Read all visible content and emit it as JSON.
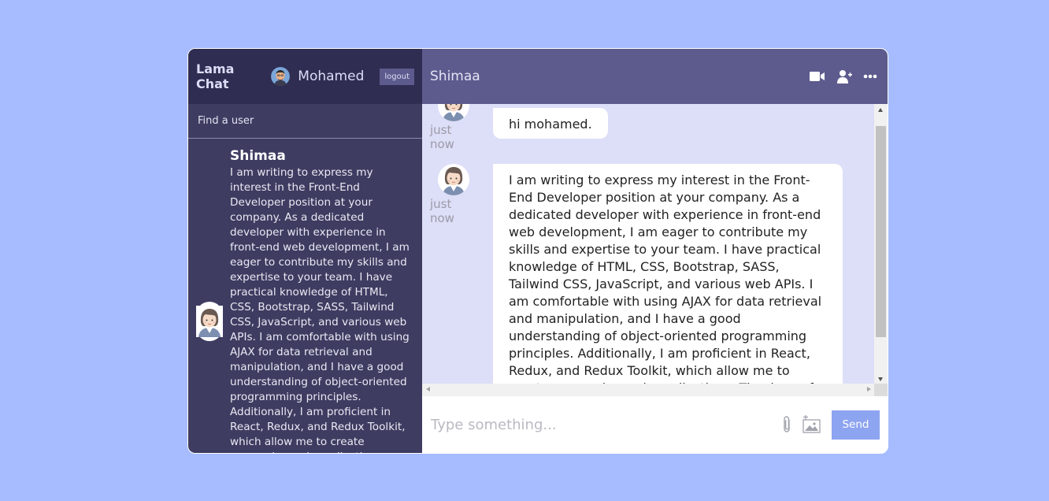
{
  "sidebar": {
    "logo": "Lama Chat",
    "current_user": "Mohamed",
    "logout_label": "logout",
    "search_placeholder": "Find a user",
    "chats": [
      {
        "name": "Shimaa",
        "last_message": "I am writing to express my interest in the Front-End Developer position at your company. As a dedicated developer with experience in front-end web development, I am eager to contribute my skills and expertise to your team. I have practical knowledge of HTML, CSS, Bootstrap, SASS, Tailwind CSS, JavaScript, and various web APIs. I am comfortable with using AJAX for data retrieval and manipulation, and I have a good understanding of object-oriented programming principles. Additionally, I am proficient in React, Redux, and Redux Toolkit, which allow me to create responsive web applications. Thank you for considering my application."
      }
    ]
  },
  "chat": {
    "header_name": "Shimaa",
    "icons": [
      "video-camera-icon",
      "add-user-icon",
      "more-icon"
    ],
    "messages": [
      {
        "time": "just now",
        "text": "hi mohamed."
      },
      {
        "time": "just now",
        "text": "I am writing to express my interest in the Front-End Developer position at your company. As a dedicated developer with experience in front-end web development, I am eager to contribute my skills and expertise to your team. I have practical knowledge of HTML, CSS, Bootstrap, SASS, Tailwind CSS, JavaScript, and various web APIs. I am comfortable with using AJAX for data retrieval and manipulation, and I have a good understanding of object-oriented programming principles. Additionally, I am proficient in React, Redux, and Redux Toolkit, which allow me to create responsive web applications. Thank you for considering my application."
      }
    ],
    "input_placeholder": "Type something...",
    "send_label": "Send"
  },
  "colors": {
    "page_bg": "#a7bcff",
    "sidebar_bg": "#3e3c61",
    "navbar_bg": "#2f2d52",
    "chat_header_bg": "#5d5b8d",
    "messages_bg": "#dddef7",
    "send_button": "#8da4f1"
  }
}
